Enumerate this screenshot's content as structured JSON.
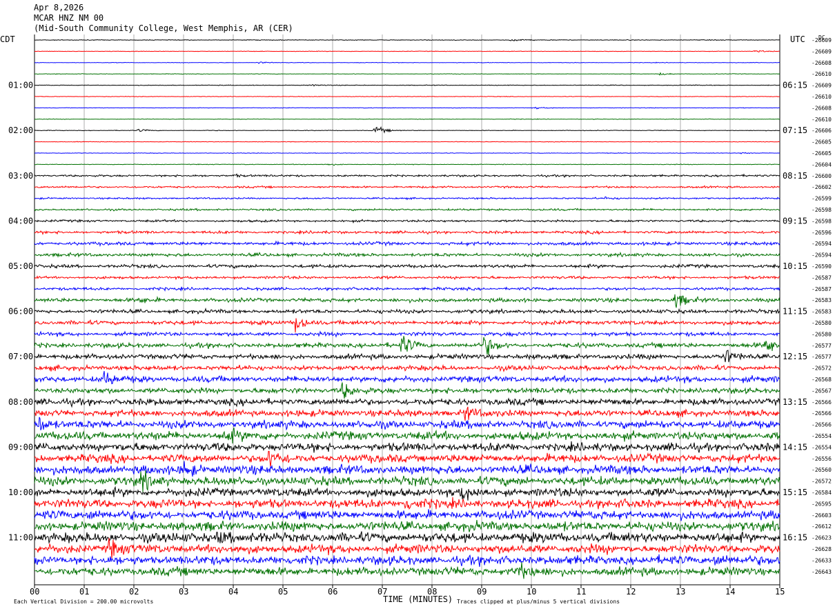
{
  "header": {
    "date": "Apr 8,2026",
    "station": "MCAR HNZ NM 00",
    "location": "(Mid-South Community College, West Memphis, AR (CER)"
  },
  "left_timezone": "CDT",
  "right_timezone": "UTC",
  "dc_label": "DC",
  "footer": {
    "scale_note": "Each Vertical Division =  200.00 microvolts",
    "axis_title": "TIME (MINUTES)",
    "clip_note": "Traces clipped at plus/minus 5 vertical divisions"
  },
  "chart_data": {
    "type": "line",
    "title": "MCAR HNZ NM 00",
    "xlabel": "TIME (MINUTES)",
    "ylabel": "",
    "xlim": [
      0,
      15
    ],
    "x_ticks": [
      "00",
      "01",
      "02",
      "03",
      "04",
      "05",
      "06",
      "07",
      "08",
      "09",
      "10",
      "11",
      "12",
      "13",
      "14",
      "15"
    ],
    "trace_minutes": 15,
    "trace_colors": [
      "#000000",
      "#ff0000",
      "#0000ff",
      "#007000"
    ],
    "grid": true,
    "left_hour_labels": [
      "01:00",
      "02:00",
      "03:00",
      "04:00",
      "05:00",
      "06:00",
      "07:00",
      "08:00",
      "09:00",
      "10:00",
      "11:00"
    ],
    "right_hour_labels": [
      "06:15",
      "07:15",
      "08:15",
      "09:15",
      "10:15",
      "11:15",
      "12:15",
      "13:15",
      "14:15",
      "15:15",
      "16:15"
    ],
    "dc_offsets": [
      -26609,
      -26609,
      -26608,
      -26610,
      -26609,
      -26610,
      -26608,
      -26610,
      -26606,
      -26605,
      -26605,
      -26604,
      -26600,
      -26602,
      -26599,
      -26598,
      -26598,
      -26596,
      -26594,
      -26594,
      -26590,
      -26587,
      -26587,
      -26583,
      -26583,
      -26580,
      -26580,
      -26577,
      -26577,
      -26572,
      -26568,
      -26567,
      -26566,
      -26566,
      -26566,
      -26554,
      -26554,
      -26556,
      -26560,
      -26572,
      -26584,
      -26595,
      -26603,
      -26612,
      -26623,
      -26628,
      -26633,
      -26643
    ],
    "noise_amplitude_divisions": [
      0.12,
      0.1,
      0.1,
      0.1,
      0.12,
      0.1,
      0.1,
      0.1,
      0.12,
      0.1,
      0.1,
      0.12,
      0.35,
      0.35,
      0.3,
      0.35,
      0.4,
      0.5,
      0.6,
      0.6,
      0.6,
      0.5,
      0.5,
      0.7,
      0.7,
      0.75,
      0.7,
      0.85,
      0.9,
      0.9,
      1.1,
      1.0,
      1.2,
      1.2,
      1.4,
      1.5,
      1.5,
      1.5,
      1.6,
      1.6,
      1.5,
      1.6,
      1.6,
      1.7,
      1.8,
      1.6,
      1.6,
      1.5
    ],
    "events": [
      {
        "trace": 0,
        "minute": 9.6,
        "amp": 0.6
      },
      {
        "trace": 1,
        "minute": 14.5,
        "amp": 0.5
      },
      {
        "trace": 2,
        "minute": 4.5,
        "amp": 0.4
      },
      {
        "trace": 3,
        "minute": 12.6,
        "amp": 0.5
      },
      {
        "trace": 4,
        "minute": 5.6,
        "amp": 0.3
      },
      {
        "trace": 6,
        "minute": 10.1,
        "amp": 0.4
      },
      {
        "trace": 8,
        "minute": 2.1,
        "amp": 0.6
      },
      {
        "trace": 8,
        "minute": 6.85,
        "amp": 2.0
      },
      {
        "trace": 10,
        "minute": 14.2,
        "amp": 0.4
      },
      {
        "trace": 11,
        "minute": 5.9,
        "amp": 0.5
      },
      {
        "trace": 12,
        "minute": 4.0,
        "amp": 0.6
      },
      {
        "trace": 14,
        "minute": 11.5,
        "amp": 0.5
      },
      {
        "trace": 23,
        "minute": 2.1,
        "amp": 1.0
      },
      {
        "trace": 23,
        "minute": 12.9,
        "amp": 3.5
      },
      {
        "trace": 25,
        "minute": 5.25,
        "amp": 4.0
      },
      {
        "trace": 27,
        "minute": 7.4,
        "amp": 4.5
      },
      {
        "trace": 27,
        "minute": 9.05,
        "amp": 4.5
      },
      {
        "trace": 27,
        "minute": 14.7,
        "amp": 4.0
      },
      {
        "trace": 28,
        "minute": 13.9,
        "amp": 3.0
      },
      {
        "trace": 30,
        "minute": 1.4,
        "amp": 3.0
      },
      {
        "trace": 31,
        "minute": 6.2,
        "amp": 3.5
      },
      {
        "trace": 33,
        "minute": 8.65,
        "amp": 3.0
      },
      {
        "trace": 34,
        "minute": 0.1,
        "amp": 3.5
      },
      {
        "trace": 35,
        "minute": 3.85,
        "amp": 3.0
      },
      {
        "trace": 37,
        "minute": 4.7,
        "amp": 3.5
      },
      {
        "trace": 38,
        "minute": 3.0,
        "amp": 3.5
      },
      {
        "trace": 39,
        "minute": 2.15,
        "amp": 4.0
      },
      {
        "trace": 40,
        "minute": 8.6,
        "amp": 3.0
      },
      {
        "trace": 41,
        "minute": 7.45,
        "amp": 3.0
      },
      {
        "trace": 42,
        "minute": 1.1,
        "amp": 2.5
      },
      {
        "trace": 44,
        "minute": 3.7,
        "amp": 2.5
      },
      {
        "trace": 45,
        "minute": 1.5,
        "amp": 3.5
      },
      {
        "trace": 46,
        "minute": 13.7,
        "amp": 2.5
      },
      {
        "trace": 47,
        "minute": 9.7,
        "amp": 3.5
      }
    ]
  }
}
